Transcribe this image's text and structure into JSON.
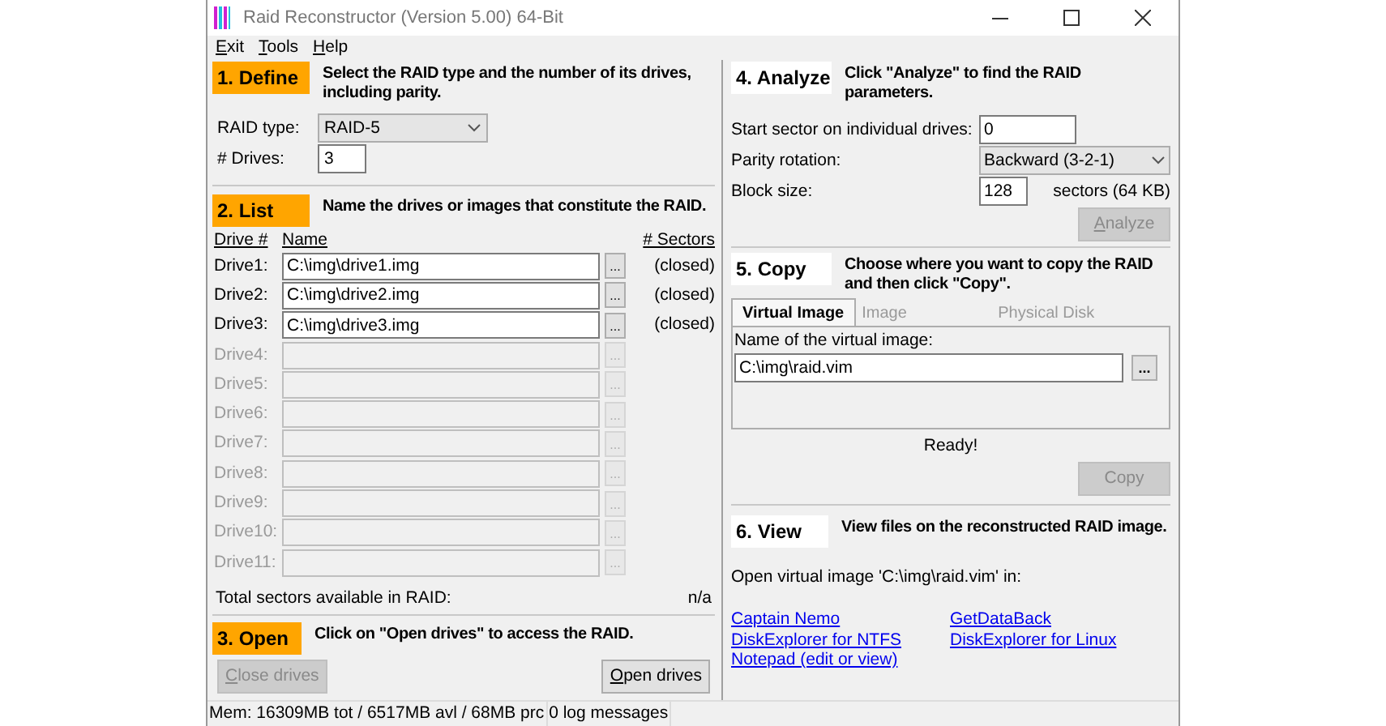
{
  "window": {
    "title": "Raid Reconstructor (Version 5.00) 64-Bit"
  },
  "menu": [
    {
      "mnemonic": "E",
      "rest": "xit"
    },
    {
      "mnemonic": "T",
      "rest": "ools"
    },
    {
      "mnemonic": "H",
      "rest": "elp"
    }
  ],
  "define": {
    "title": "1. Define",
    "active": true,
    "description": "Select the RAID type and the number of its drives, including parity.",
    "raid_type_label": "RAID type:",
    "raid_type": "RAID-5",
    "drives_label": "# Drives:",
    "drives": "3"
  },
  "list": {
    "title": "2. List",
    "active": true,
    "description": "Name the drives or images that constitute the RAID.",
    "columns": [
      "Drive #",
      "Name",
      "# Sectors"
    ],
    "drives": [
      {
        "label": "Drive1:",
        "path": "C:\\img\\drive1.img",
        "sectors": "(closed)",
        "enabled": true,
        "browse": "..."
      },
      {
        "label": "Drive2:",
        "path": "C:\\img\\drive2.img",
        "sectors": "(closed)",
        "enabled": true,
        "browse": "..."
      },
      {
        "label": "Drive3:",
        "path": "C:\\img\\drive3.img",
        "sectors": "(closed)",
        "enabled": true,
        "browse": "..."
      },
      {
        "label": "Drive4:",
        "enabled": false,
        "browse": "..."
      },
      {
        "label": "Drive5:",
        "enabled": false,
        "browse": "..."
      },
      {
        "label": "Drive6:",
        "enabled": false,
        "browse": "..."
      },
      {
        "label": "Drive7:",
        "enabled": false,
        "browse": "..."
      },
      {
        "label": "Drive8:",
        "enabled": false,
        "browse": "..."
      },
      {
        "label": "Drive9:",
        "enabled": false,
        "browse": "..."
      },
      {
        "label": "Drive10:",
        "enabled": false,
        "browse": "..."
      },
      {
        "label": "Drive11:",
        "enabled": false,
        "browse": "..."
      }
    ],
    "total_label": "Total sectors available in RAID:",
    "total": "n/a"
  },
  "open": {
    "title": "3. Open",
    "active": true,
    "description": "Click on \"Open drives\" to access the RAID.",
    "buttons": [
      {
        "mnemonic": "C",
        "rest": "lose drives",
        "disabled": true
      },
      {
        "mnemonic": "O",
        "rest": "pen drives",
        "disabled": false
      }
    ]
  },
  "analyze": {
    "title": "4. Analyze",
    "active": false,
    "description": "Click \"Analyze\" to find the RAID parameters.",
    "start_label": "Start sector on individual drives:",
    "start": "0",
    "parity_label": "Parity rotation:",
    "parity": "Backward (3-2-1)",
    "block_label": "Block size:",
    "block": "128",
    "block_unit": "sectors (64 KB)",
    "button": {
      "mnemonic": "A",
      "rest": "nalyze",
      "disabled": true
    }
  },
  "copy": {
    "title": "5. Copy",
    "active": false,
    "description": "Choose where you want to copy the RAID and then click \"Copy\".",
    "tabs": [
      {
        "label": "Virtual Image",
        "selected": true
      },
      {
        "label": "Image",
        "selected": false
      },
      {
        "label": "Physical Disk",
        "selected": false
      }
    ],
    "name_label": "Name of the virtual image:",
    "name": "C:\\img\\raid.vim",
    "browse": "...",
    "status": "Ready!",
    "button": {
      "label": "Copy",
      "disabled": true
    }
  },
  "view": {
    "title": "6. View",
    "active": false,
    "description": "View files on the reconstructed RAID image.",
    "intro": "Open virtual image 'C:\\img\\raid.vim' in:",
    "links": [
      "Captain Nemo",
      "GetDataBack",
      "DiskExplorer for NTFS",
      "DiskExplorer for Linux",
      "Notepad (edit or view)"
    ]
  },
  "status_bar": [
    "Mem: 16309MB tot / 6517MB avl / 68MB prc",
    "0 log messages"
  ]
}
